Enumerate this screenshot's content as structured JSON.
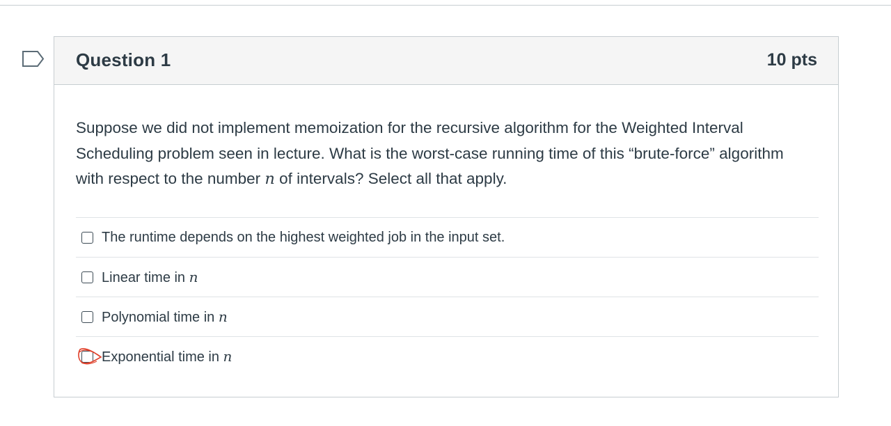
{
  "question": {
    "title": "Question 1",
    "points": "10 pts",
    "flag_icon": "flag-outline-icon",
    "prompt_part1": "Suppose we did not implement memoization for the recursive algorithm for the Weighted Interval Scheduling problem seen in lecture. What is the worst-case running time of this “brute-force” algorithm with respect to the number ",
    "prompt_var": "n",
    "prompt_part2": " of intervals? Select all that apply."
  },
  "answers": [
    {
      "label": "The runtime depends on the highest weighted job in the input set.",
      "var": "",
      "checked": false
    },
    {
      "label": "Linear time in ",
      "var": "n",
      "checked": false
    },
    {
      "label": "Polynomial time in ",
      "var": "n",
      "checked": false
    },
    {
      "label": "Exponential time in ",
      "var": "n",
      "checked": false,
      "annotation": "red-pen-scribble"
    }
  ],
  "colors": {
    "text": "#2d3b45",
    "header_bg": "#f5f5f5",
    "border": "#c7cdd1",
    "annotation": "#e0402a"
  }
}
